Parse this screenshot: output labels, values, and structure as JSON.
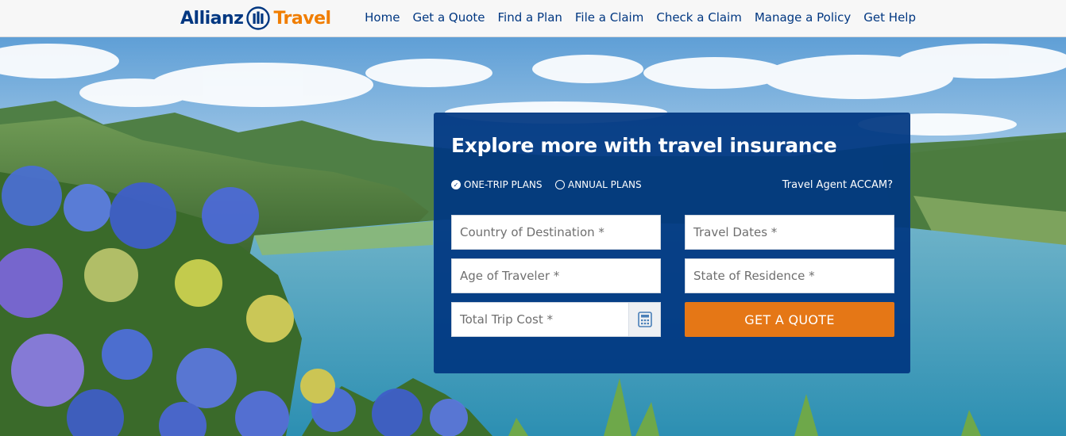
{
  "header": {
    "logo": {
      "brand": "Allianz",
      "product": "Travel",
      "mark_icon": "allianz-eagle-icon"
    },
    "nav": [
      "Home",
      "Get a Quote",
      "Find a Plan",
      "File a Claim",
      "Check a Claim",
      "Manage a Policy",
      "Get Help"
    ]
  },
  "quote_panel": {
    "title": "Explore more with travel insurance",
    "plan_types": [
      {
        "label": "ONE-TRIP PLANS",
        "selected": true
      },
      {
        "label": "ANNUAL PLANS",
        "selected": false
      }
    ],
    "agent_link": "Travel Agent ACCAM?",
    "fields": {
      "destination": "Country of Destination *",
      "dates": "Travel Dates *",
      "age": "Age of Traveler *",
      "state": "State of Residence *",
      "trip_cost": "Total Trip Cost *"
    },
    "trip_cost_icon": "calculator-icon",
    "submit_label": "GET A QUOTE"
  },
  "colors": {
    "brand_blue": "#003781",
    "accent_orange": "#e57716",
    "logo_orange": "#f07d00"
  }
}
